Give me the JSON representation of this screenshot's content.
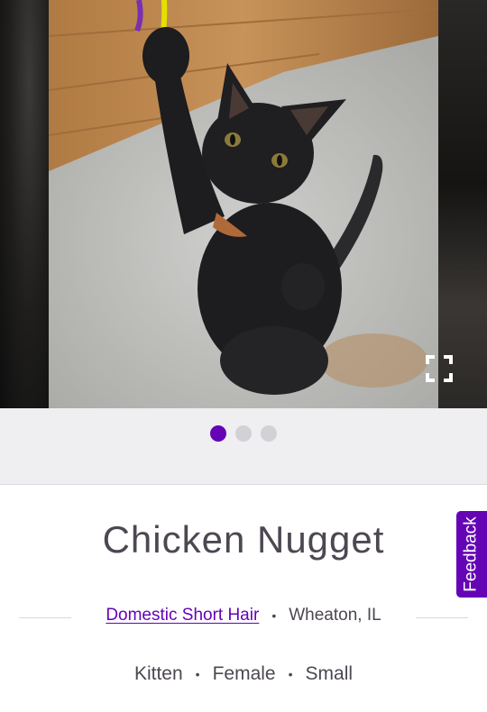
{
  "pet": {
    "name": "Chicken Nugget",
    "breed": "Domestic Short Hair",
    "location": "Wheaton, IL",
    "age": "Kitten",
    "gender": "Female",
    "size": "Small"
  },
  "separator": "•",
  "carousel": {
    "photo_count": 3,
    "active_index": 0
  },
  "feedback": {
    "label": "Feedback"
  },
  "colors": {
    "accent": "#6504b5",
    "text": "#4d4751",
    "band": "#efeef1"
  },
  "icons": {
    "expand": "expand-fullscreen-icon"
  }
}
